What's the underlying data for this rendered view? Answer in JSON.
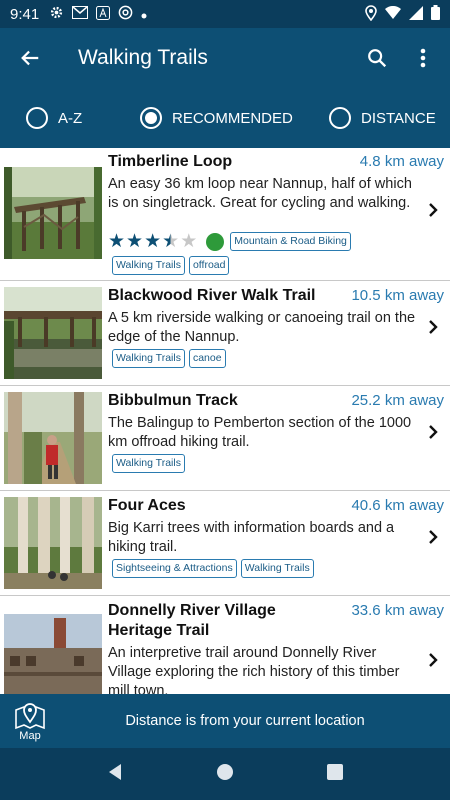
{
  "status_bar": {
    "time": "9:41"
  },
  "app_bar": {
    "title": "Walking Trails"
  },
  "sort": {
    "options": [
      {
        "label": "A-Z",
        "selected": false
      },
      {
        "label": "RECOMMENDED",
        "selected": true
      },
      {
        "label": "DISTANCE",
        "selected": false
      }
    ]
  },
  "trails": [
    {
      "name": "Timberline Loop",
      "distance": "4.8 km away",
      "description": "An easy 36 km loop near Nannup, half of which is on singletrack. Great for cycling and walking.",
      "rating": 3.5,
      "rating_max": 5,
      "tags": [
        "Mountain & Road Biking",
        "Walking Trails",
        "offroad"
      ]
    },
    {
      "name": "Blackwood River Walk Trail",
      "distance": "10.5 km away",
      "description": "A 5 km riverside walking or canoeing trail on the edge of the Nannup.",
      "tags": [
        "Walking Trails",
        "canoe"
      ]
    },
    {
      "name": "Bibbulmun Track",
      "distance": "25.2 km away",
      "description": "The Balingup to Pemberton section of the 1000 km offroad hiking trail.",
      "tags": [
        "Walking Trails"
      ]
    },
    {
      "name": "Four Aces",
      "distance": "40.6 km away",
      "description": "Big Karri trees with information boards and a hiking trail.",
      "tags": [
        "Sightseeing & Attractions",
        "Walking Trails"
      ]
    },
    {
      "name": "Donnelly River Village Heritage Trail",
      "distance": "33.6 km away",
      "description": "An interpretive trail around Donnelly River Village exploring the rich history of this timber mill town."
    }
  ],
  "bottom_bar": {
    "map_label": "Map",
    "note": "Distance is from your current location"
  },
  "colors": {
    "primary": "#0d4f74",
    "status": "#0b3d5c",
    "accent": "#2a7bb0",
    "star": "#0d4f74",
    "green_badge": "#2e9a3a"
  }
}
